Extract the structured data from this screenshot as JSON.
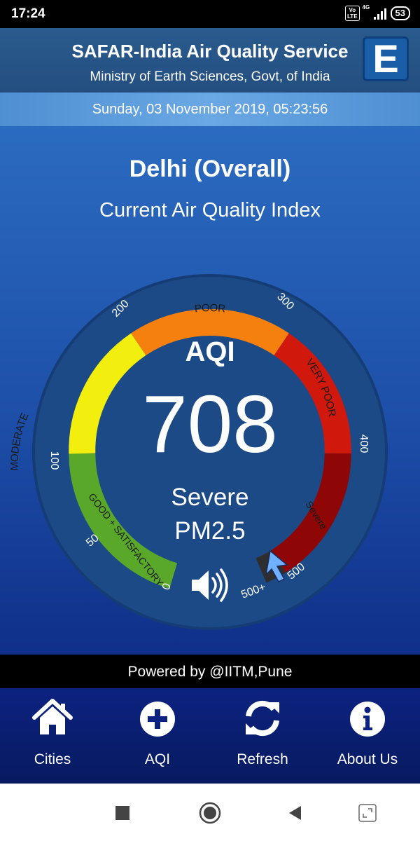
{
  "status_bar": {
    "time": "17:24",
    "volte_line1": "Vo",
    "volte_line2": "LTE",
    "network_type": "4G",
    "battery": "53"
  },
  "header": {
    "title": "SAFAR-India Air Quality Service",
    "subtitle": "Ministry of Earth Sciences, Govt, of India",
    "logo_letter": "E"
  },
  "date_time": "Sunday, 03 November 2019, 05:23:56",
  "city": {
    "name": "Delhi (Overall)",
    "subtitle": "Current Air Quality Index"
  },
  "gauge": {
    "aqi_label": "AQI",
    "aqi_value": "708",
    "category": "Severe",
    "pollutant": "PM2.5",
    "ticks": [
      "0",
      "50",
      "100",
      "200",
      "300",
      "400",
      "500",
      "500+"
    ],
    "segments": [
      {
        "label": "GOOD + SATISFACTORY",
        "color": "#5aa82a"
      },
      {
        "label": "MODERATE",
        "color": "#f2ee0e"
      },
      {
        "label": "POOR",
        "color": "#f5800e"
      },
      {
        "label": "VERY POOR",
        "color": "#d0180c"
      },
      {
        "label": "Severe",
        "color": "#8e0606"
      },
      {
        "label": "",
        "color": "#2a2a2a"
      }
    ]
  },
  "footer": {
    "powered_by": "Powered by @IITM,Pune"
  },
  "bottom_nav": [
    {
      "label": "Cities",
      "icon": "home-icon"
    },
    {
      "label": "AQI",
      "icon": "plus-circle-icon"
    },
    {
      "label": "Refresh",
      "icon": "refresh-icon"
    },
    {
      "label": "About Us",
      "icon": "info-icon"
    }
  ]
}
